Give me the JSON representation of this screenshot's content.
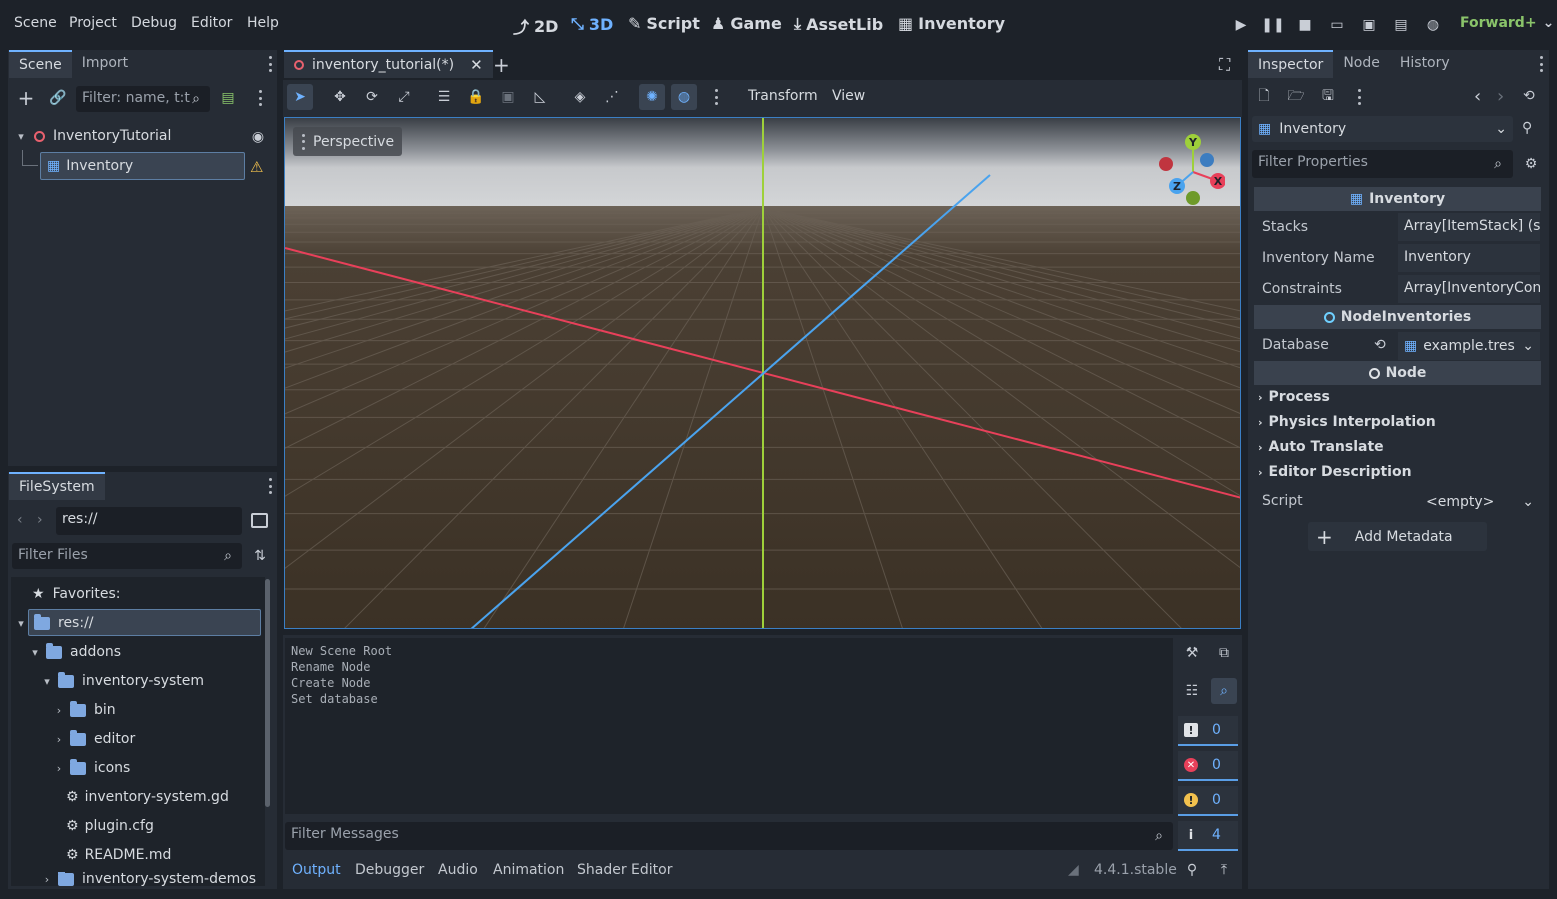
{
  "menu": [
    "Scene",
    "Project",
    "Debug",
    "Editor",
    "Help"
  ],
  "workspaces": {
    "w2d": "2D",
    "w3d": "3D",
    "script": "Script",
    "game": "Game",
    "assetlib": "AssetLib",
    "inventory": "Inventory"
  },
  "renderer": "Forward+",
  "scene_dock": {
    "tabs": [
      "Scene",
      "Import"
    ],
    "filter_placeholder": "Filter: name, t:t",
    "root_node": "InventoryTutorial",
    "child_node": "Inventory"
  },
  "filesystem": {
    "tab": "FileSystem",
    "path": "res://",
    "filter_placeholder": "Filter Files",
    "favorites": "Favorites:",
    "root": "res://",
    "items": [
      "addons",
      "inventory-system",
      "bin",
      "editor",
      "icons",
      "inventory-system.gd",
      "plugin.cfg",
      "README.md",
      "inventory-system-demos"
    ]
  },
  "editor_tab": {
    "name": "inventory_tutorial(*)"
  },
  "viewport_toolbar": {
    "transform": "Transform",
    "view": "View",
    "perspective": "Perspective"
  },
  "gizmo": {
    "x": "X",
    "y": "Y",
    "z": "Z"
  },
  "output": {
    "lines": [
      "New Scene Root",
      "Rename Node",
      "Create Node",
      "Set database"
    ],
    "filter_placeholder": "Filter Messages",
    "counts": {
      "errors": "0",
      "error2": "0",
      "warnings": "0",
      "info": "4"
    },
    "tabs": [
      "Output",
      "Debugger",
      "Audio",
      "Animation",
      "Shader Editor"
    ],
    "version": "4.4.1.stable"
  },
  "inspector": {
    "tabs": [
      "Inspector",
      "Node",
      "History"
    ],
    "object": "Inventory",
    "filter_placeholder": "Filter Properties",
    "section_inventory": "Inventory",
    "props": [
      {
        "label": "Stacks",
        "value": "Array[ItemStack] (si"
      },
      {
        "label": "Inventory Name",
        "value": "Inventory"
      },
      {
        "label": "Constraints",
        "value": "Array[InventoryCon"
      }
    ],
    "section_node_inventories": "NodeInventories",
    "database_label": "Database",
    "database_value": "example.tres",
    "section_node": "Node",
    "groups": [
      "Process",
      "Physics Interpolation",
      "Auto Translate",
      "Editor Description"
    ],
    "script_label": "Script",
    "script_value": "<empty>",
    "add_metadata": "Add Metadata"
  },
  "colors": {
    "accent": "#6fb2ff",
    "axis_x": "#e8405a",
    "axis_y": "#9ed03a",
    "axis_z": "#4aa3ee",
    "ground": "#3d3329"
  }
}
